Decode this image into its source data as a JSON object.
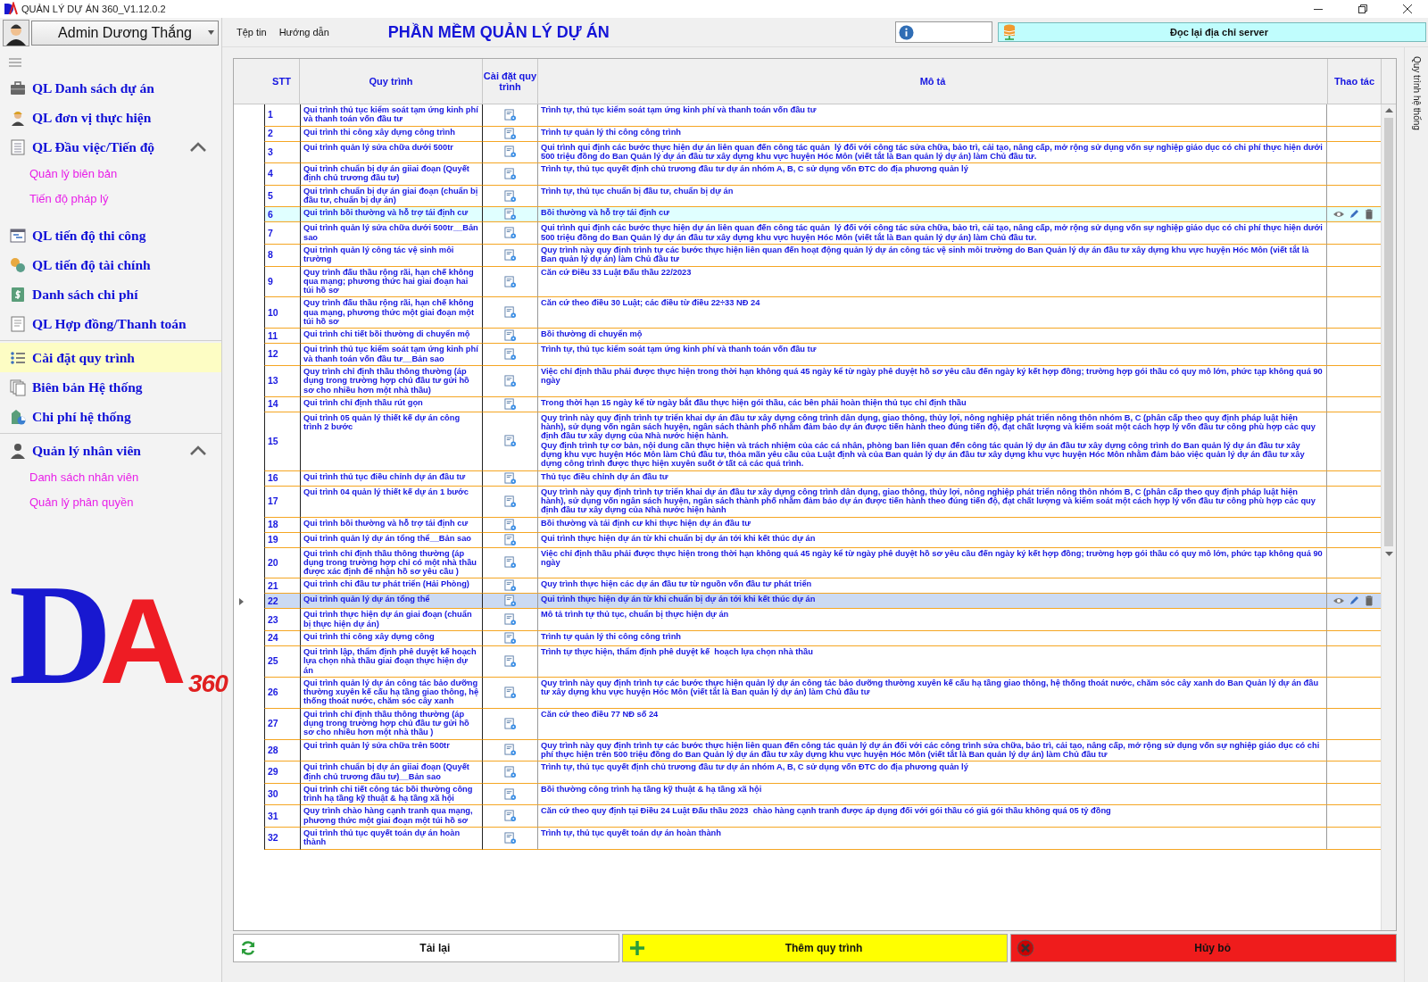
{
  "window": {
    "title": "QUẢN LÝ DỰ ÁN 360_V1.12.0.2"
  },
  "header": {
    "user": "Admin Dương Thắng",
    "menu": [
      "Tệp tin",
      "Hướng dẫn"
    ],
    "app_title": "PHẦN MỀM QUẢN LÝ DỰ ÁN",
    "server_button": "Đọc lại địa chỉ server"
  },
  "sidebar": {
    "items": [
      {
        "kind": "item",
        "label": "QL Danh sách dự án",
        "selected": false
      },
      {
        "kind": "item",
        "label": "QL đơn vị thực hiện",
        "selected": false
      },
      {
        "kind": "group",
        "label": "QL Đầu việc/Tiến độ",
        "expanded": true,
        "children": [
          {
            "label": "Quản lý biên bản"
          },
          {
            "label": "Tiến độ pháp lý"
          }
        ]
      },
      {
        "kind": "item",
        "label": "QL tiến độ thi công",
        "selected": false
      },
      {
        "kind": "item",
        "label": "QL tiến độ tài chính",
        "selected": false
      },
      {
        "kind": "item",
        "label": "Danh sách chi phí",
        "selected": false
      },
      {
        "kind": "item",
        "label": "QL Hợp đồng/Thanh toán",
        "selected": false
      },
      {
        "kind": "divider"
      },
      {
        "kind": "item",
        "label": "Cài đặt quy trình",
        "selected": true
      },
      {
        "kind": "item",
        "label": "Biên bản Hệ thống",
        "selected": false
      },
      {
        "kind": "item",
        "label": "Chi phí hệ thống",
        "selected": false
      },
      {
        "kind": "divider"
      },
      {
        "kind": "group",
        "label": "Quản lý nhân viên",
        "expanded": true,
        "children": [
          {
            "label": "Danh sách nhân viên"
          },
          {
            "label": "Quản lý phân quyền"
          }
        ]
      }
    ],
    "logo": {
      "letter_1": "D",
      "letter_2": "A",
      "version": "360"
    }
  },
  "table": {
    "columns": [
      "STT",
      "Quy trình",
      "Cài đặt quy trình",
      "Mô tả",
      "Thao tác"
    ],
    "rows": [
      {
        "stt": "1",
        "name": "Qui trình thủ tục kiểm soát tạm ứng kinh phí và thanh toán vốn đầu tư",
        "description": "Trình tự, thủ tục kiểm soát tạm ứng kinh phí và thanh toán vốn đầu tư",
        "highlighted": false,
        "selected": false
      },
      {
        "stt": "2",
        "name": "Qui trình thi công xây dựng công trình",
        "description": "Trình tự quản lý thi công công trình",
        "highlighted": false,
        "selected": false
      },
      {
        "stt": "3",
        "name": "Qui trình quản lý sửa chữa dưới 500tr",
        "description": "Qui trình qui định các bước thực hiện dự án liên quan đến công tác quản  lý đối với công tác sửa chữa, bảo trì, cải tạo, nâng cấp, mở rộng sử dụng vốn sự nghiệp giáo dục có chi phí thực hiện dưới 500 triệu đồng do Ban Quản lý dự án đầu tư xây dựng khu vực huyện Hóc Môn (viết tắt là Ban quản lý dự án) làm Chủ đầu tư.",
        "highlighted": false,
        "selected": false
      },
      {
        "stt": "4",
        "name": "Qui trình chuẩn bị dự án giiai đoạn (Quyết định chủ trương đầu tư)",
        "description": "Trình tự, thủ tục quyết định chủ trương đầu tư dự án nhóm A, B, C sử dụng vốn ĐTC do địa phương quản lý",
        "highlighted": false,
        "selected": false
      },
      {
        "stt": "5",
        "name": "Qui trình chuẩn bị dự án giai đoạn (chuẩn bị đầu tư, chuẩn bị dự án)",
        "description": "Trình tự, thủ tục chuẩn bị đầu tư, chuẩn bị dự án",
        "highlighted": false,
        "selected": false
      },
      {
        "stt": "6",
        "name": "Qui trình bồi thường và hỗ trợ tái định cư",
        "description": "Bồi thường và hỗ trợ tái định cư",
        "highlighted": true,
        "selected": false
      },
      {
        "stt": "7",
        "name": "Qui trình quản lý sửa chữa dưới 500tr__Bản sao",
        "description": "Qui trình qui định các bước thực hiện dự án liên quan đến công tác quản  lý đối với công tác sửa chữa, bảo trì, cải tạo, nâng cấp, mở rộng sử dụng vốn sự nghiệp giáo dục có chi phí thực hiện dưới 500 triệu đồng do Ban Quản lý dự án đầu tư xây dựng khu vực huyện Hóc Môn (viết tắt là Ban quản lý dự án) làm Chủ đầu tư.",
        "highlighted": false,
        "selected": false
      },
      {
        "stt": "8",
        "name": "Qui trình quản lý công tác vệ sinh môi trường",
        "description": "Quy trình này quy định trình tự các bước thực hiện liên quan đến hoạt động quản lý dự án công tác vệ sinh môi trường do Ban Quản lý dự án đầu tư xây dựng khu vực huyện Hóc Môn (viết tắt là Ban quản lý dự án) làm Chủ đầu tư",
        "highlighted": false,
        "selected": false
      },
      {
        "stt": "9",
        "name": "Quy trình đấu thầu rộng rãi, hạn chế không qua mạng; phương thức hai giai đoạn hai túi hồ sơ",
        "description": "Căn cứ Điều 33 Luật Đấu thầu 22/2023",
        "highlighted": false,
        "selected": false
      },
      {
        "stt": "10",
        "name": "Quy trình đấu thầu rộng rãi, hạn chế không qua mạng, phương thức một giai đoạn một túi hồ sơ",
        "description": "Căn cứ theo điều 30 Luật; các điều từ điều 22÷33 NĐ 24",
        "highlighted": false,
        "selected": false
      },
      {
        "stt": "11",
        "name": "Qui trình chi tiết bồi thường di chuyển mộ",
        "description": "Bồi thường di chuyển mộ",
        "highlighted": false,
        "selected": false
      },
      {
        "stt": "12",
        "name": "Qui trình thủ tục kiểm soát tạm ứng kinh phí và thanh toán vốn đầu tư__Bản sao",
        "description": "Trình tự, thủ tục kiểm soát tạm ứng kinh phí và thanh toán vốn đầu tư",
        "highlighted": false,
        "selected": false
      },
      {
        "stt": "13",
        "name": "Quy trình chỉ định thầu thông thường (áp dụng trong trường hợp chủ đầu tư gửi hồ sơ cho nhiều hơn một nhà thầu)",
        "description": "Việc chỉ định thầu phải được thực hiện trong thời hạn không quá 45 ngày kể từ ngày phê duyệt hồ sơ yêu cầu đến ngày ký kết hợp đồng; trường hợp gói thầu có quy mô lớn, phức tạp không quá 90 ngày",
        "highlighted": false,
        "selected": false
      },
      {
        "stt": "14",
        "name": "Qui trình chỉ định thầu rút gọn",
        "description": "Trong thời hạn 15 ngày kể từ ngày bắt đầu thực hiện gói thầu, các bên phải hoàn thiện thủ tục chỉ định thầu",
        "highlighted": false,
        "selected": false
      },
      {
        "stt": "15",
        "name": "Qui trình 05 quản lý thiết kế dự án công trình 2 bước",
        "description": "Quy trình này quy định trình tự triển khai dự án đầu tư xây dựng công trình dân dụng, giao thông, thủy lợi, nông nghiệp phát triển nông thôn nhóm B, C (phân cấp theo quy định pháp luật hiện hành), sử dụng vốn ngân sách huyện, ngân sách thành phố nhằm đảm bảo dự án được tiến hành theo đúng tiến độ, đạt chất lượng và kiểm soát một cách hợp lý vốn đầu tư công phù hợp các quy định đầu tư xây dựng của Nhà nước hiện hành.\nQuy định trình tự cơ bản, nội dung cần thực hiện và trách nhiệm của các cá nhân, phòng ban liên quan đến công tác quản lý dự án đầu tư xây dựng công trình do Ban quản lý dự án đầu tư xây dựng khu vực huyện Hóc Môn làm Chủ đầu tư, thỏa mãn yêu cầu của Luật định và của Ban quản lý dự án đầu tư xây dựng khu vực huyện Hóc Môn nhằm đảm bảo việc quản lý dự án đầu tư xây dựng công trình được thực hiện xuyên suốt ở tất cả các quá trình.",
        "highlighted": false,
        "selected": false
      },
      {
        "stt": "16",
        "name": "Qui trình thủ tục điều chỉnh dự án đầu tư",
        "description": "Thủ tục điều chỉnh dự án đầu tư",
        "highlighted": false,
        "selected": false
      },
      {
        "stt": "17",
        "name": "Qui trình 04 quản lý thiết kế dự án 1 bước",
        "description": "Quy trình này quy định trình tự triển khai dự án đầu tư xây dựng công trình dân dụng, giao thông, thủy lợi, nông nghiệp phát triển nông thôn nhóm B, C (phân cấp theo quy định pháp luật hiện hành), sử dụng vốn ngân sách huyện, ngân sách thành phố nhằm đảm bảo dự án được tiến hành theo đúng tiến độ, đạt chất lượng và kiểm soát một cách hợp lý vốn đầu tư công phù hợp các quy định đầu tư xây dựng của Nhà nước hiện hành",
        "highlighted": false,
        "selected": false
      },
      {
        "stt": "18",
        "name": "Qui trình bồi thường và hỗ trợ tái định cư",
        "description": "Bồi thường và tái định cư khi thực hiện dự án đầu tư",
        "highlighted": false,
        "selected": false
      },
      {
        "stt": "19",
        "name": "Qui trình quản lý dự án tổng thể__Bản sao",
        "description": "Qui trình thực hiện dự án từ khi chuẩn bị dự án tới khi kết thúc dự án",
        "highlighted": false,
        "selected": false
      },
      {
        "stt": "20",
        "name": "Qui trình chỉ định thầu thông thường (áp dụng trong trường hợp chỉ có một nhà thầu được xác định để nhận hồ sơ yêu cầu )",
        "description": "Việc chỉ định thầu phải được thực hiện trong thời hạn không quá 45 ngày kể từ ngày phê duyệt hồ sơ yêu cầu đến ngày ký kết hợp đồng; trường hợp gói thầu có quy mô lớn, phức tạp không quá 90 ngày",
        "highlighted": false,
        "selected": false
      },
      {
        "stt": "21",
        "name": "Qui trình chi đầu tư phát triển (Hải Phòng)",
        "description": "Quy trình thực hiện các dự án đầu tư từ nguồn vốn đầu tư phát triển",
        "highlighted": false,
        "selected": false
      },
      {
        "stt": "22",
        "name": "Qui trình quản lý dự án tổng thể",
        "description": "Qui trình thực hiện dự án từ khi chuẩn bị dự án tới khi kết thúc dự án",
        "highlighted": false,
        "selected": true
      },
      {
        "stt": "23",
        "name": "Qui trình thực hiện dự án giai đoạn (chuẩn bị thực hiện dự án)",
        "description": "Mô tả trình tự thủ tục, chuẩn bị thực hiện dự án",
        "highlighted": false,
        "selected": false
      },
      {
        "stt": "24",
        "name": "Qui trình thi công xây dựng công",
        "description": "Trình tự quản lý thi công công trình",
        "highlighted": false,
        "selected": false
      },
      {
        "stt": "25",
        "name": "Qui trình lập, thẩm định phê duyệt kế hoạch lựa chọn nhà thầu giai đoạn thực hiện dự án",
        "description": "Trình tự thực hiện, thẩm định phê duyệt kế  hoạch lựa chọn nhà thầu",
        "highlighted": false,
        "selected": false
      },
      {
        "stt": "26",
        "name": "Qui trình quản lý dự án công tác bảo dưỡng thường xuyên kế cấu hạ tầng giao thông, hệ thống thoát nước, chăm sóc cây xanh",
        "description": "Quy trình này quy định trình tự các bước thực hiện quản lý dự án công tác bảo dưỡng thường xuyên kế cấu hạ tầng giao thông, hệ thống thoát nước, chăm sóc cây xanh do Ban Quản lý dự án đầu tư xây dựng khu vực huyện Hóc Môn (viết tắt là Ban quản lý dự án) làm Chủ đầu tư",
        "highlighted": false,
        "selected": false
      },
      {
        "stt": "27",
        "name": "Qui trình chỉ định thầu thông thường (áp dụng trong trường hợp chủ đầu tư gửi hồ sơ cho nhiều hơn một nhà thầu )",
        "description": "Căn cứ theo điều 77 NĐ số 24",
        "highlighted": false,
        "selected": false
      },
      {
        "stt": "28",
        "name": "Qui trình quản lý sửa chữa trên 500tr",
        "description": "Quy trình này quy định trình tự các bước thực hiện liên quan đến công tác quản lý dự án đối với các công trình sửa chữa, bảo trì, cải tạo, nâng cấp, mở rộng sử dụng vốn sự nghiệp giáo dục có chi phí thực hiện trên 500 triệu đồng do Ban Quản lý dự án đầu tư xây dựng khu vực huyện Hóc Môn (viết tắt là Ban quản lý dự án) làm Chủ đầu tư",
        "highlighted": false,
        "selected": false
      },
      {
        "stt": "29",
        "name": "Qui trình chuẩn bị dự án giiai đoạn (Quyết định chủ trương đầu tư)__Bản sao",
        "description": "Trình tự, thủ tục quyết định chủ trương đầu tư dự án nhóm A, B, C sử dụng vốn ĐTC do địa phương quản lý",
        "highlighted": false,
        "selected": false
      },
      {
        "stt": "30",
        "name": "Qui trình chi tiết công tác bồi thường công trình hạ tầng kỹ thuật & hạ tầng xã hội",
        "description": "Bồi thường công trình hạ tầng kỹ thuật & hạ tầng xã hội",
        "highlighted": false,
        "selected": false
      },
      {
        "stt": "31",
        "name": "Quy trình chào hàng cạnh tranh qua mạng, phương thức một giai đoạn một túi hồ sơ",
        "description": "Căn cứ theo quy định tại Điều 24 Luật Đấu thầu 2023  chào hàng cạnh tranh được áp dụng đối với gói thầu có giá gói thầu không quá 05 tỷ đồng",
        "highlighted": false,
        "selected": false
      },
      {
        "stt": "32",
        "name": "Qui trình thủ tục quyết toán dự án hoàn thành",
        "description": "Trình tự, thủ tục quyết toán dự án hoàn thành",
        "highlighted": false,
        "selected": false
      }
    ]
  },
  "side_tab": "Quy trình hệ thống",
  "buttons": [
    {
      "kind": "reload",
      "label": "Tải lại"
    },
    {
      "kind": "add",
      "label": "Thêm quy trình"
    },
    {
      "kind": "cancel",
      "label": "Hủy bỏ"
    }
  ]
}
